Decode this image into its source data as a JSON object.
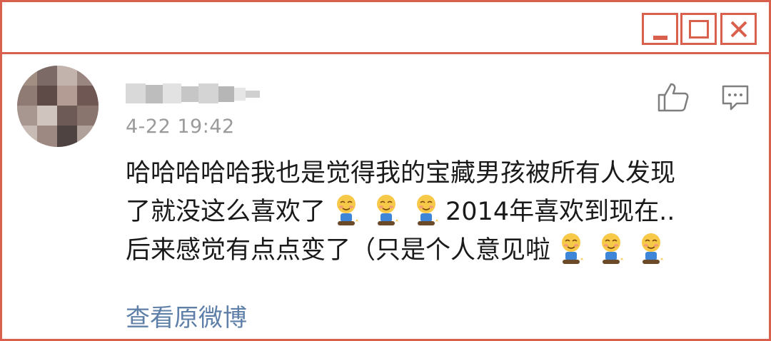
{
  "window": {
    "minimize_icon": "minimize-icon",
    "maximize_icon": "maximize-icon",
    "close_icon": "close-icon",
    "accent_color": "#d9604c"
  },
  "comment": {
    "username_obscured": true,
    "timestamp": "4-22 19:42",
    "lines": [
      "哈哈哈哈哈我也是觉得我的宝藏男孩被所有人发现",
      "了就没这么喜欢了",
      "2014年喜欢到现在..",
      "后来感觉有点点变了（只是个人意见啦"
    ],
    "emoji_name": "shy-sitting-boy-emoji",
    "actions": {
      "like_icon": "thumbs-up-icon",
      "reply_icon": "comment-bubble-icon"
    },
    "view_original": "查看原微博",
    "link_color": "#5d7fa8"
  }
}
